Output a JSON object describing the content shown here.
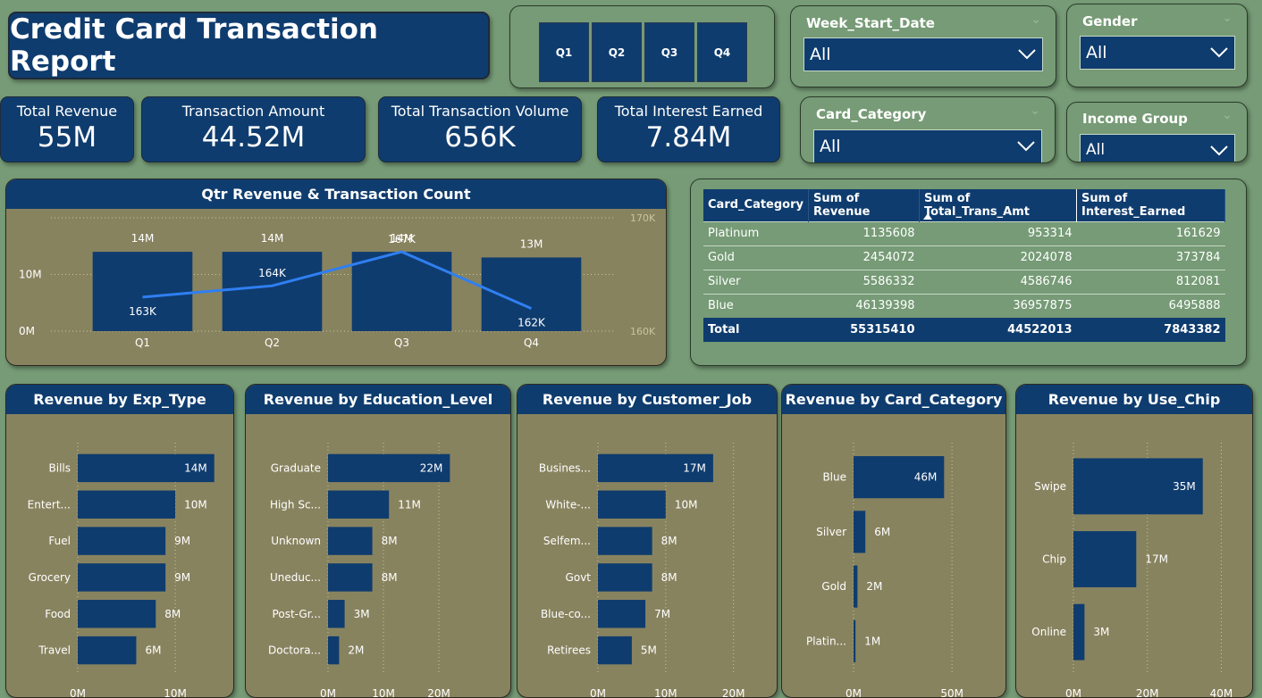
{
  "title": "Credit Card Transaction Report",
  "quarter_buttons": [
    "Q1",
    "Q2",
    "Q3",
    "Q4"
  ],
  "slicers": {
    "week_start_date": {
      "label": "Week_Start_Date",
      "value": "All"
    },
    "gender": {
      "label": "Gender",
      "value": "All"
    },
    "card_category": {
      "label": "Card_Category",
      "value": "All"
    },
    "income_group": {
      "label": "Income Group",
      "value": "All"
    }
  },
  "kpis": {
    "total_revenue": {
      "label": "Total Revenue",
      "value": "55M"
    },
    "transaction_amount": {
      "label": "Transaction Amount",
      "value": "44.52M"
    },
    "total_transaction_volume": {
      "label": "Total Transaction Volume",
      "value": "656K"
    },
    "total_interest_earned": {
      "label": "Total Interest Earned",
      "value": "7.84M"
    }
  },
  "colors": {
    "bar": "#0f3c6e",
    "line": "#2f7ff2",
    "panel": "#88835f",
    "background": "#769b76"
  },
  "table": {
    "columns": [
      "Card_Category",
      "Sum of Revenue",
      "Sum of Total_Trans_Amt",
      "Sum of Interest_Earned"
    ],
    "sorted_column_icon": "sort-ascending-icon",
    "rows": [
      [
        "Platinum",
        "1135608",
        "953314",
        "161629"
      ],
      [
        "Gold",
        "2454072",
        "2024078",
        "373784"
      ],
      [
        "Silver",
        "5586332",
        "4586746",
        "812081"
      ],
      [
        "Blue",
        "46139398",
        "36957875",
        "6495888"
      ]
    ],
    "total": [
      "Total",
      "55315410",
      "44522013",
      "7843382"
    ]
  },
  "chart_data": [
    {
      "type": "bar+line",
      "title": "Qtr Revenue & Transaction Count",
      "categories": [
        "Q1",
        "Q2",
        "Q3",
        "Q4"
      ],
      "bar_values": [
        14,
        14,
        14,
        13
      ],
      "bar_labels": [
        "14M",
        "14M",
        "14M",
        "13M"
      ],
      "line_values": [
        163,
        164,
        167,
        162
      ],
      "line_labels": [
        "163K",
        "164K",
        "167K",
        "162K"
      ],
      "y_ticks": [
        "0M",
        "10M"
      ],
      "y2_ticks": [
        "160K",
        "170K"
      ],
      "ylim": [
        0,
        20
      ],
      "y2lim": [
        160,
        170
      ]
    },
    {
      "type": "bar",
      "orientation": "horizontal",
      "title": "Revenue by Exp_Type",
      "categories": [
        "Bills",
        "Entert...",
        "Fuel",
        "Grocery",
        "Food",
        "Travel"
      ],
      "values": [
        14,
        10,
        9,
        9,
        8,
        6
      ],
      "labels": [
        "14M",
        "10M",
        "9M",
        "9M",
        "8M",
        "6M"
      ],
      "x_ticks": [
        "0M",
        "10M"
      ],
      "xlim": [
        0,
        14.3
      ]
    },
    {
      "type": "bar",
      "orientation": "horizontal",
      "title": "Revenue by Education_Level",
      "categories": [
        "Graduate",
        "High Sc...",
        "Unknown",
        "Uneduc...",
        "Post-Gr...",
        "Doctora..."
      ],
      "values": [
        22,
        11,
        8,
        8,
        3,
        2
      ],
      "labels": [
        "22M",
        "11M",
        "8M",
        "8M",
        "3M",
        "2M"
      ],
      "x_ticks": [
        "0M",
        "10M",
        "20M"
      ],
      "xlim": [
        0,
        30
      ]
    },
    {
      "type": "bar",
      "orientation": "horizontal",
      "title": "Revenue by Customer_Job",
      "categories": [
        "Busines...",
        "White-...",
        "Selfem...",
        "Govt",
        "Blue-co...",
        "Retirees"
      ],
      "values": [
        17,
        10,
        8,
        8,
        7,
        5
      ],
      "labels": [
        "17M",
        "10M",
        "8M",
        "8M",
        "7M",
        "5M"
      ],
      "x_ticks": [
        "0M",
        "10M",
        "20M"
      ],
      "xlim": [
        0,
        24
      ]
    },
    {
      "type": "bar",
      "orientation": "horizontal",
      "title": "Revenue by Card_Category",
      "categories": [
        "Blue",
        "Silver",
        "Gold",
        "Platin..."
      ],
      "values": [
        46,
        6,
        2,
        1
      ],
      "labels": [
        "46M",
        "6M",
        "2M",
        "1M"
      ],
      "x_ticks": [
        "0M",
        "50M"
      ],
      "xlim": [
        0,
        69
      ]
    },
    {
      "type": "bar",
      "orientation": "horizontal",
      "title": "Revenue by Use_Chip",
      "categories": [
        "Swipe",
        "Chip",
        "Online"
      ],
      "values": [
        35,
        17,
        3
      ],
      "labels": [
        "35M",
        "17M",
        "3M"
      ],
      "x_ticks": [
        "0M",
        "20M",
        "40M"
      ],
      "xlim": [
        0,
        44
      ]
    }
  ]
}
